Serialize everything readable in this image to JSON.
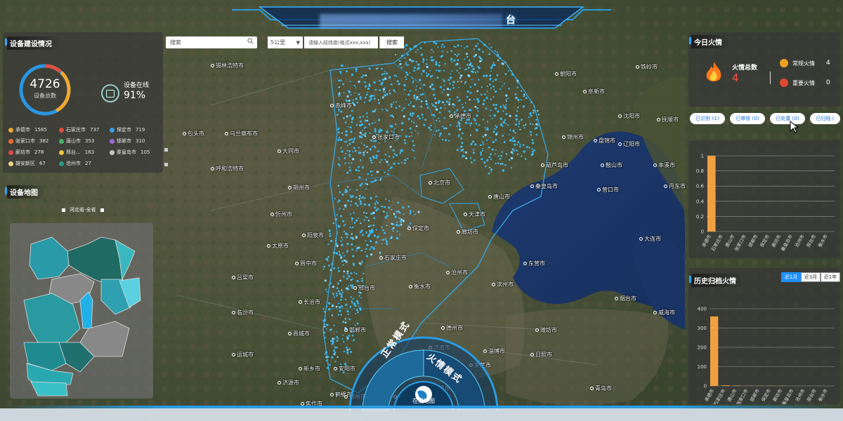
{
  "header": {
    "title": "台"
  },
  "search": {
    "placeholder": "搜索",
    "distance": "5公里",
    "coord_placeholder": "请输入经纬度(格式xxx,xxx)",
    "button": "搜索"
  },
  "device_stats": {
    "title": "设备建设情况",
    "total": "4726",
    "total_label": "设备总数",
    "online_label": "设备在线",
    "online_pct": "91%",
    "online_fraction": 0.91,
    "cities": [
      {
        "name": "承德市",
        "count": "1585",
        "color": "#f0a830"
      },
      {
        "name": "石家庄市",
        "count": "737",
        "color": "#e0503c"
      },
      {
        "name": "保定市",
        "count": "719",
        "color": "#3aa0e8"
      },
      {
        "name": "张家口市",
        "count": "382",
        "color": "#e86a2c"
      },
      {
        "name": "唐山市",
        "count": "353",
        "color": "#4ab06a"
      },
      {
        "name": "邯郸市",
        "count": "310",
        "color": "#9a6ad8"
      },
      {
        "name": "廊坊市",
        "count": "278",
        "color": "#e04a4a"
      },
      {
        "name": "邢台...",
        "count": "163",
        "color": "#f0c040"
      },
      {
        "name": "秦皇岛市",
        "count": "105",
        "color": "#c8c8c8"
      },
      {
        "name": "雄安新区",
        "count": "67",
        "color": "#f0d080"
      },
      {
        "name": "沧州市",
        "count": "27",
        "color": "#2a9a8a"
      }
    ]
  },
  "device_map": {
    "title": "设备地图",
    "selector": "河北省-全省"
  },
  "today_fire": {
    "title": "今日火情",
    "total_label": "火情总数",
    "total": "4",
    "normal_label": "常规火情",
    "normal": "4",
    "major_label": "重要火情",
    "major": "0"
  },
  "status_pills": [
    "已识别 (1)",
    "已审核 (0)",
    "已处置 (0)",
    "已归档 ("
  ],
  "chart_today": {
    "type": "bar",
    "categories": [
      "承德市",
      "石家庄市",
      "唐山市",
      "张家口市",
      "邯郸市",
      "保定市",
      "廊坊市",
      "秦皇岛市",
      "沧州市",
      "邢台市",
      "衡水市"
    ],
    "values": [
      1,
      0,
      0,
      0,
      0,
      0,
      0,
      0,
      0,
      0,
      0
    ],
    "ylim": [
      0,
      1
    ],
    "yticks": [
      "0",
      "0.2",
      "0.4",
      "0.6",
      "0.8",
      "1"
    ]
  },
  "history_fire": {
    "title": "历史归档火情",
    "tabs": [
      "近1月",
      "近3月",
      "近1年"
    ],
    "active": 0
  },
  "chart_history": {
    "type": "bar",
    "categories": [
      "承德市",
      "石家庄市",
      "唐山市",
      "张家口市",
      "邯郸市",
      "保定市",
      "廊坊市",
      "秦皇岛市",
      "沧州市",
      "邢台市",
      "衡水市"
    ],
    "values": [
      360,
      3,
      2,
      1,
      1,
      1,
      1,
      0,
      0,
      0,
      0
    ],
    "ylim": [
      0,
      400
    ],
    "yticks": [
      "0",
      "100",
      "200",
      "300",
      "400"
    ]
  },
  "bottom_dial": {
    "left": "正常模式",
    "right": "火情模式",
    "center": "在线地图"
  },
  "map_labels": [
    "锡林浩特市",
    "赤峰市",
    "朝阳市",
    "阜新市",
    "铁岭市",
    "沈阳市",
    "抚顺市",
    "辽阳市",
    "本溪市",
    "鞍山市",
    "营口市",
    "丹东市",
    "锦州市",
    "盘锦市",
    "葫芦岛市",
    "大连市",
    "乌兰察布市",
    "呼和浩特市",
    "包头市",
    "大同市",
    "朔州市",
    "忻州市",
    "太原市",
    "阳泉市",
    "晋中市",
    "吕梁市",
    "临汾市",
    "长治市",
    "晋城市",
    "运城市",
    "北京市",
    "天津市",
    "唐山市",
    "秦皇岛市",
    "承德市",
    "张家口市",
    "保定市",
    "廊坊市",
    "沧州市",
    "石家庄市",
    "衡水市",
    "邢台市",
    "邯郸市",
    "德州市",
    "滨州市",
    "东营市",
    "淄博市",
    "潍坊市",
    "烟台市",
    "威海市",
    "青岛市",
    "济南市",
    "泰安市",
    "莱芜市",
    "日照市",
    "聊城市",
    "安阳市",
    "鹤壁市",
    "新乡市",
    "焦作市",
    "济源市",
    "郑州市",
    "开封市",
    "濮阳市",
    "菏泽市",
    "商丘市"
  ]
}
